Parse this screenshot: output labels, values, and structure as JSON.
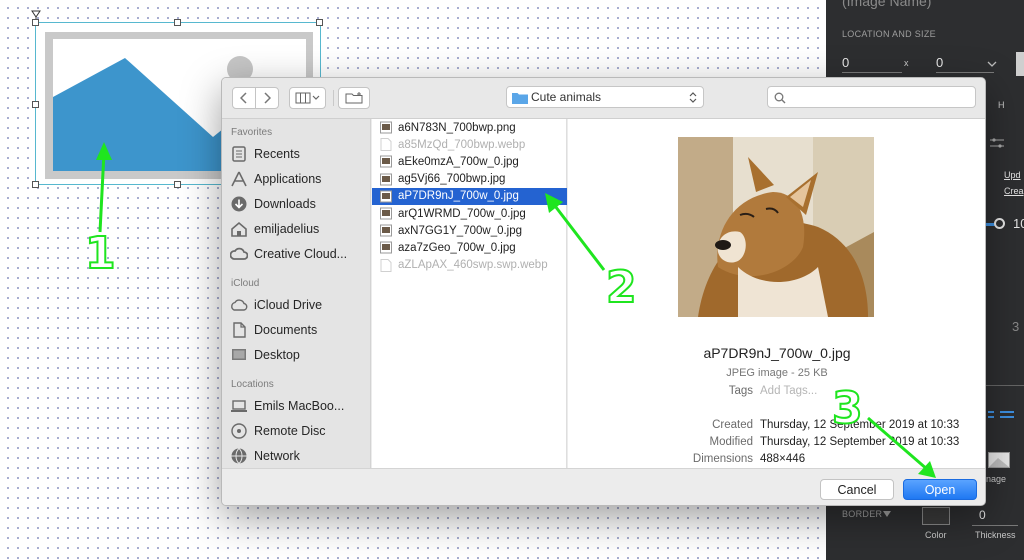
{
  "inspector": {
    "header": "(Image Name)",
    "location_label": "LOCATION AND SIZE",
    "x_value": "0",
    "x_axis": "x",
    "y_value": "0",
    "h_label": "H",
    "link_update": "Upd",
    "link_create": "Crea",
    "opacity_value": "10",
    "stroke_value": "3",
    "image_label": "nage",
    "border_label": "BORDER",
    "color_label": "Color",
    "thickness_value": "0",
    "thickness_label": "Thickness"
  },
  "dialog": {
    "location": "Cute animals",
    "search_placeholder": "",
    "sidebar": {
      "favorites_title": "Favorites",
      "favorites": [
        {
          "label": "Recents",
          "icon": "recents-icon"
        },
        {
          "label": "Applications",
          "icon": "applications-icon"
        },
        {
          "label": "Downloads",
          "icon": "downloads-icon"
        },
        {
          "label": "emiljadelius",
          "icon": "home-icon"
        },
        {
          "label": "Creative Cloud...",
          "icon": "creative-cloud-icon"
        }
      ],
      "icloud_title": "iCloud",
      "icloud": [
        {
          "label": "iCloud Drive",
          "icon": "cloud-icon"
        },
        {
          "label": "Documents",
          "icon": "documents-icon"
        },
        {
          "label": "Desktop",
          "icon": "desktop-icon"
        }
      ],
      "locations_title": "Locations",
      "locations": [
        {
          "label": "Emils MacBoo...",
          "icon": "laptop-icon"
        },
        {
          "label": "Remote Disc",
          "icon": "disc-icon"
        },
        {
          "label": "Network",
          "icon": "network-icon"
        }
      ]
    },
    "files": [
      {
        "name": "a6N783N_700bwp.png",
        "state": "normal"
      },
      {
        "name": "a85MzQd_700bwp.webp",
        "state": "dim"
      },
      {
        "name": "aEke0mzA_700w_0.jpg",
        "state": "normal"
      },
      {
        "name": "ag5Vj66_700bwp.jpg",
        "state": "normal"
      },
      {
        "name": "aP7DR9nJ_700w_0.jpg",
        "state": "selected"
      },
      {
        "name": "arQ1WRMD_700w_0.jpg",
        "state": "normal"
      },
      {
        "name": "axN7GG1Y_700w_0.jpg",
        "state": "normal"
      },
      {
        "name": "aza7zGeo_700w_0.jpg",
        "state": "normal"
      },
      {
        "name": "aZLApAX_460swp.swp.webp",
        "state": "dim"
      }
    ],
    "preview": {
      "filename": "aP7DR9nJ_700w_0.jpg",
      "kind": "JPEG image - 25 KB",
      "tags_label": "Tags",
      "tags_placeholder": "Add Tags...",
      "created_label": "Created",
      "created_value": "Thursday, 12 September 2019 at 10:33",
      "modified_label": "Modified",
      "modified_value": "Thursday, 12 September 2019 at 10:33",
      "dimensions_label": "Dimensions",
      "dimensions_value": "488×446"
    },
    "cancel_label": "Cancel",
    "open_label": "Open"
  },
  "annotations": {
    "step1": "1",
    "step2": "2",
    "step3": "3",
    "color": "#1fe51f"
  }
}
